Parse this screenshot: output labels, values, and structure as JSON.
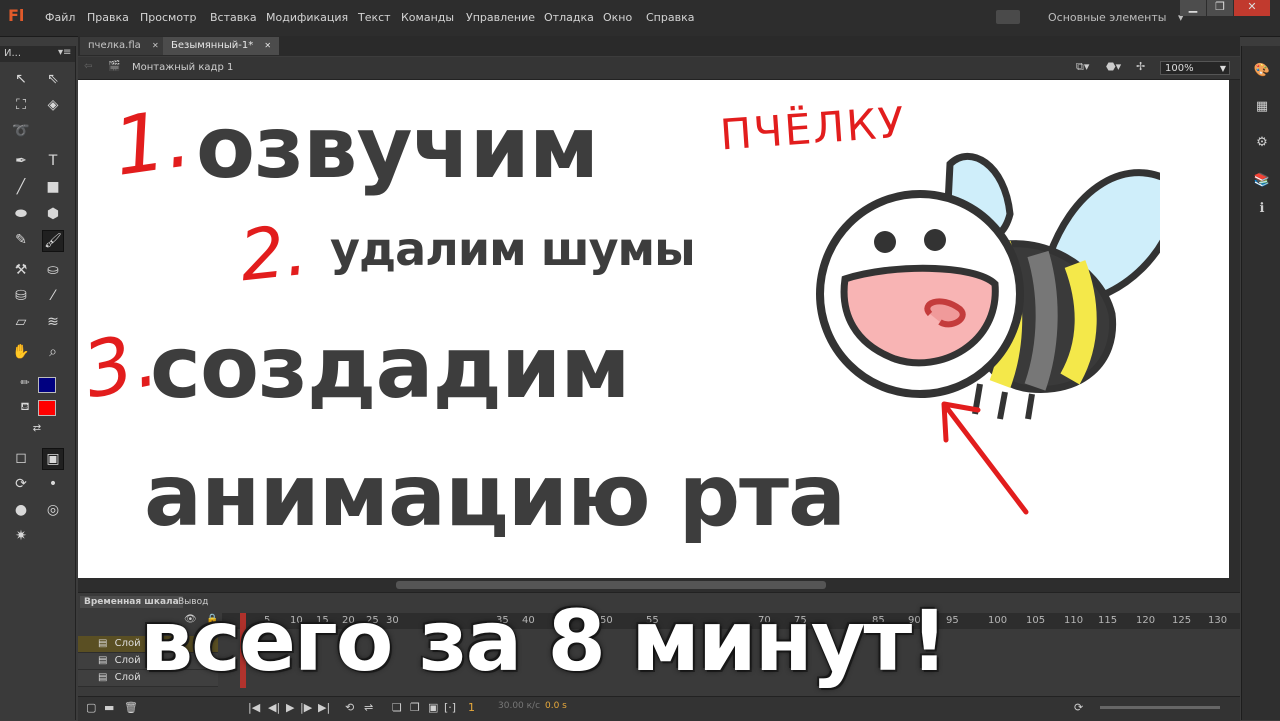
{
  "app": {
    "logo": "Fl"
  },
  "menu": [
    "Файл",
    "Правка",
    "Просмотр",
    "Вставка",
    "Модификация",
    "Текст",
    "Команды",
    "Управление",
    "Отладка",
    "Окно",
    "Справка"
  ],
  "workspace": {
    "label": "Основные элементы",
    "arrow": "▾"
  },
  "window_controls": {
    "minimize": "▁",
    "maximize": "❐",
    "close": "✕"
  },
  "tabs": [
    {
      "label": "пчелка.fla",
      "close": "✕"
    },
    {
      "label": "Безымянный-1*",
      "close": "✕"
    }
  ],
  "tools_panel": {
    "title": "И...",
    "menu": "▾≡"
  },
  "editbar": {
    "scene": "Монтажный кадр 1",
    "zoom": "100%"
  },
  "stage": {
    "lines": [
      "озвучим",
      "удалим шумы",
      "создадим",
      "анимацию рта"
    ],
    "numbers": [
      "1.",
      "2.",
      "3."
    ],
    "handwritten": "ПЧЁЛКУ"
  },
  "timeline": {
    "tabs": [
      "Временная шкала",
      "Вывод"
    ],
    "frame_numbers": [
      "5",
      "10",
      "15",
      "20",
      "25",
      "30",
      "35",
      "40",
      "45",
      "50",
      "55",
      "60",
      "65",
      "70",
      "75",
      "80",
      "85",
      "90",
      "95",
      "100",
      "105",
      "110",
      "115",
      "120",
      "125",
      "130"
    ],
    "layers": [
      "Слой",
      "Слой",
      "Слой"
    ],
    "current_frame": "1",
    "fps": "30.00 к/с",
    "time": "0.0 s"
  },
  "caption": "всего за 8 минут!",
  "colors": {
    "stroke": "#000080",
    "fill": "#ff0000",
    "accent_red": "#e21d1d",
    "stage_text": "#3d3d3d"
  },
  "icons": [
    "selection-icon",
    "subselection-icon",
    "free-transform-icon",
    "3d-rotation-icon",
    "lasso-icon",
    "pen-icon",
    "text-icon",
    "line-icon",
    "rectangle-icon",
    "oval-icon",
    "polystar-icon",
    "pencil-icon",
    "brush-icon",
    "bone-icon",
    "paint-bucket-icon",
    "ink-bottle-icon",
    "eyedropper-icon",
    "eraser-icon",
    "width-icon",
    "hand-icon",
    "zoom-icon"
  ]
}
